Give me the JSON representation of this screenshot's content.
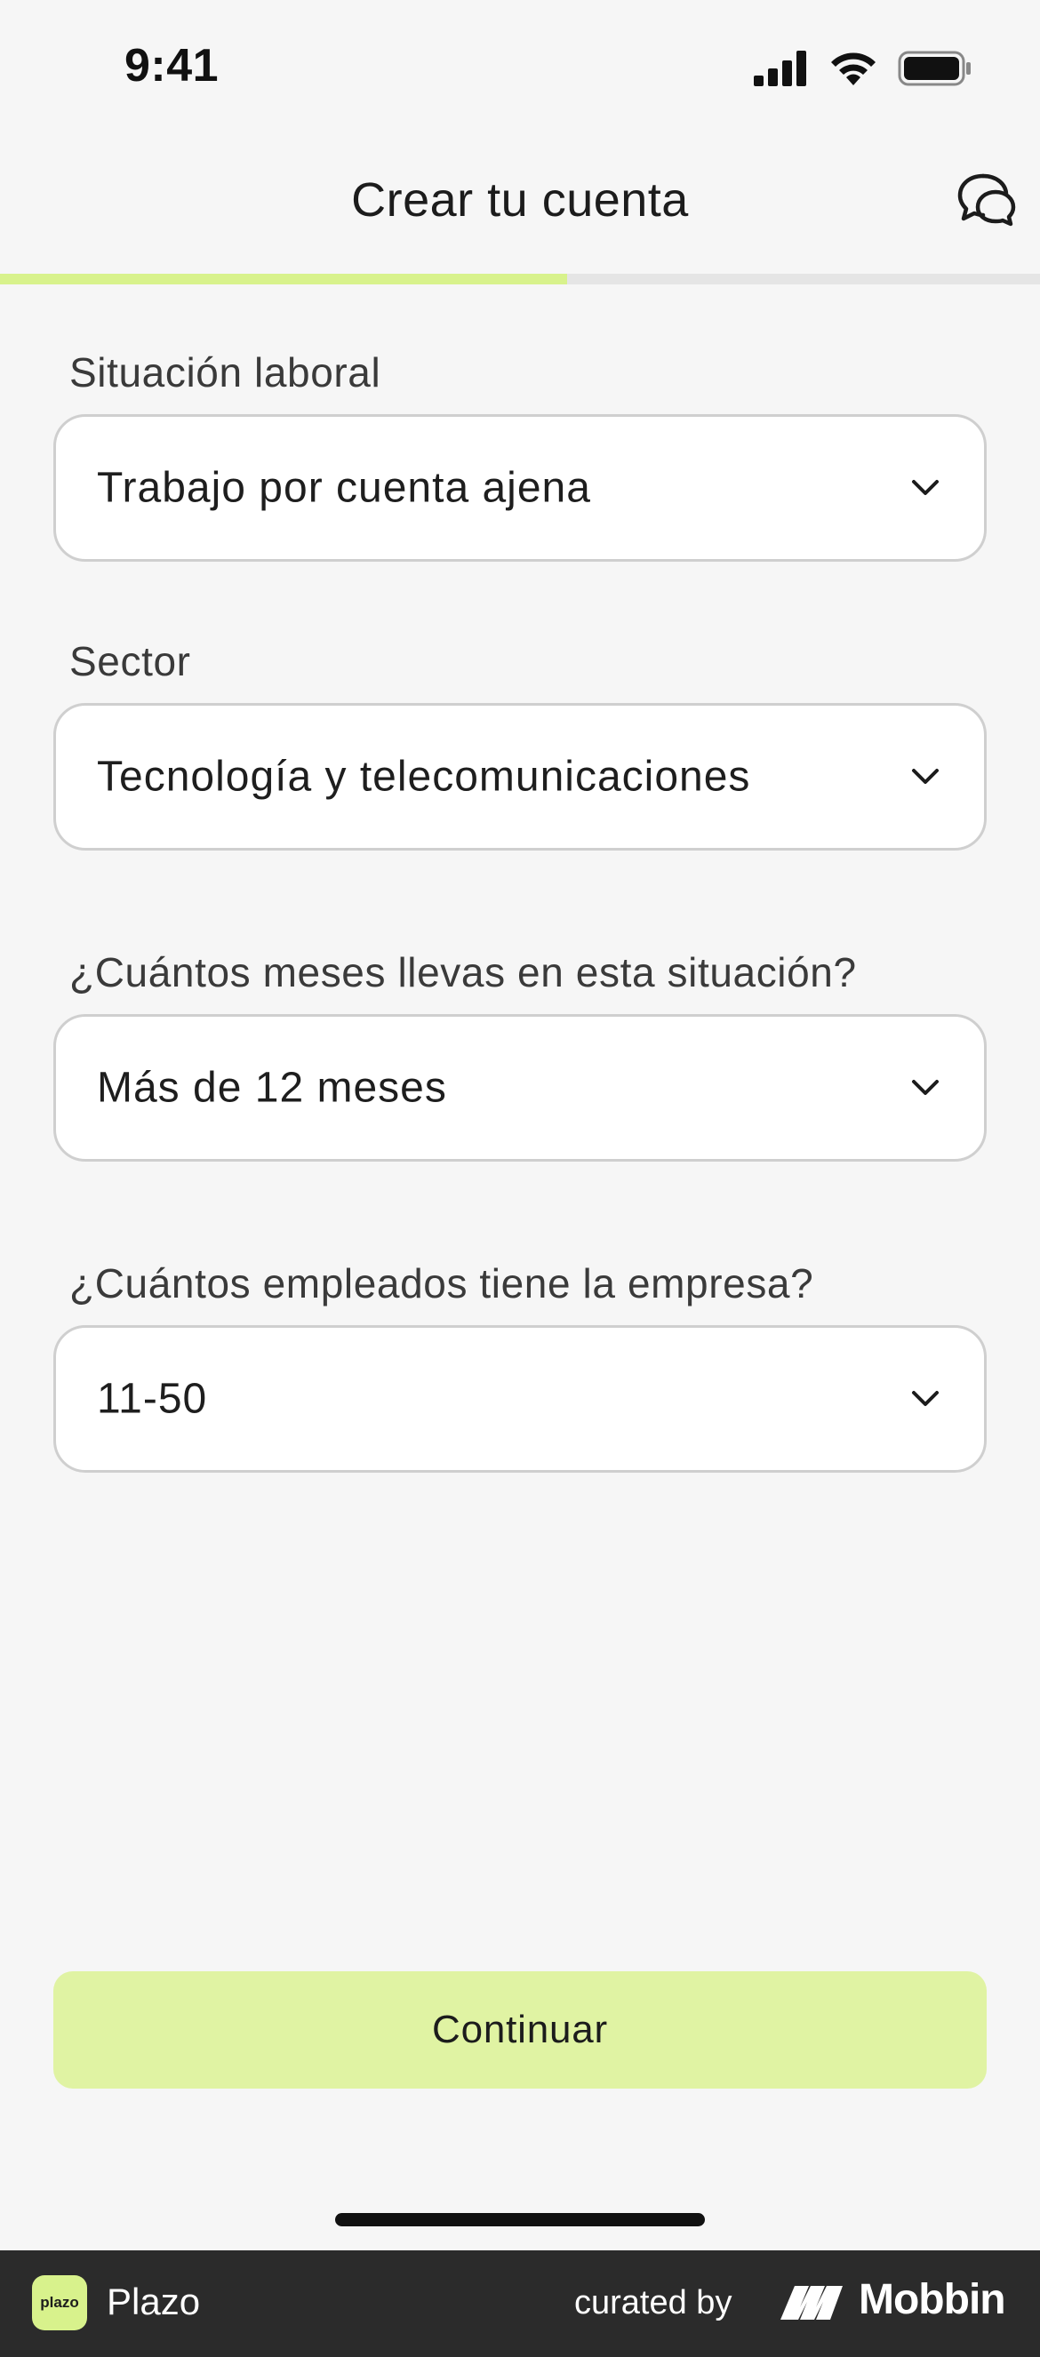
{
  "status_bar": {
    "time": "9:41",
    "icons": [
      "cellular-signal-icon",
      "wifi-icon",
      "battery-icon"
    ]
  },
  "header": {
    "title": "Crear tu cuenta",
    "chat_icon": "chat-bubbles-icon"
  },
  "progress": {
    "value": 0.545,
    "fill_color": "#d8f28c",
    "track_color": "#e5e5e5"
  },
  "form": {
    "fields": [
      {
        "label": "Situación laboral",
        "value": "Trabajo por cuenta ajena"
      },
      {
        "label": "Sector",
        "value": "Tecnología y telecomunicaciones"
      },
      {
        "label": "¿Cuántos meses llevas en esta situación?",
        "value": "Más de 12 meses"
      },
      {
        "label": "¿Cuántos empleados tiene la empresa?",
        "value": "11-50"
      }
    ]
  },
  "continue_button": {
    "label": "Continuar",
    "color": "#e0f3a3"
  },
  "footer": {
    "logo_text": "plazo",
    "app_name": "Plazo",
    "curated_by": "curated by",
    "brand": "Mobbin"
  }
}
